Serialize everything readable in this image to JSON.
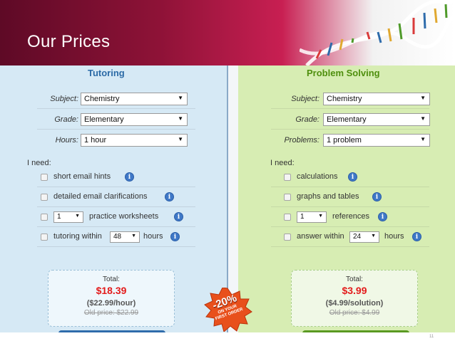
{
  "slide": {
    "title": "Our Prices",
    "slide_number": "11"
  },
  "tutoring": {
    "title": "Tutoring",
    "fields": [
      {
        "label": "Subject:",
        "value": "Chemistry"
      },
      {
        "label": "Grade:",
        "value": "Elementary"
      },
      {
        "label": "Hours:",
        "value": "1 hour"
      }
    ],
    "need_label": "I need:",
    "options": {
      "opt1": "short email hints",
      "opt2": "detailed email clarifications",
      "opt3_select": "1",
      "opt3": "practice worksheets",
      "opt4_prefix": "tutoring within",
      "opt4_select": "48",
      "opt4_suffix": "hours"
    },
    "total": {
      "label": "Total:",
      "price": "$18.39",
      "rate": "($22.99/hour)",
      "old_price": "Old price: $22.99"
    }
  },
  "problem_solving": {
    "title": "Problem Solving",
    "fields": [
      {
        "label": "Subject:",
        "value": "Chemistry"
      },
      {
        "label": "Grade:",
        "value": "Elementary"
      },
      {
        "label": "Problems:",
        "value": "1 problem"
      }
    ],
    "need_label": "I need:",
    "options": {
      "opt1": "calculations",
      "opt2": "graphs and tables",
      "opt3_select": "1",
      "opt3": "references",
      "opt4_prefix": "answer within",
      "opt4_select": "24",
      "opt4_suffix": "hours"
    },
    "total": {
      "label": "Total:",
      "price": "$3.99",
      "rate": "($4.99/solution)",
      "old_price": "Old price: $4.99"
    }
  },
  "badge": {
    "percent": "-20%",
    "line1": "ON YOUR",
    "line2": "FIRST ORDER"
  },
  "icons": {
    "info": "info-icon",
    "dropdown": "chevron-down-icon",
    "dna": "dna-helix-graphic"
  },
  "colors": {
    "banner_dark": "#5e0a26",
    "banner_mid": "#c81f52",
    "tutoring_bg": "#d6e9f5",
    "tutoring_title": "#2b6aa6",
    "problem_bg": "#d7edb3",
    "problem_title": "#4f8f0e",
    "price_red": "#e31b1b",
    "badge_orange": "#e8501c"
  }
}
